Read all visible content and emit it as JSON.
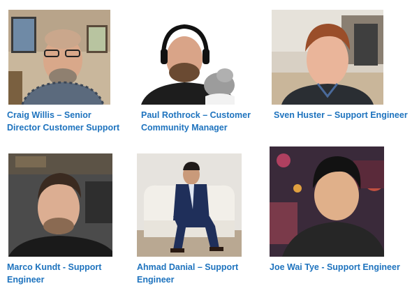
{
  "team": [
    {
      "line1": "Craig Willis – Senior",
      "line2": "Director Customer Support"
    },
    {
      "line1": "Paul Rothrock – Customer",
      "line2": "Community Manager"
    },
    {
      "line1": "Sven Huster – Support Engineer",
      "line2": ""
    },
    {
      "line1": "Marco Kundt - Support",
      "line2": "Engineer"
    },
    {
      "line1": "Ahmad Danial – Support",
      "line2": "Engineer"
    },
    {
      "line1": "Joe Wai Tye - Support Engineer",
      "line2": ""
    }
  ],
  "colors": {
    "caption": "#1e73be"
  }
}
